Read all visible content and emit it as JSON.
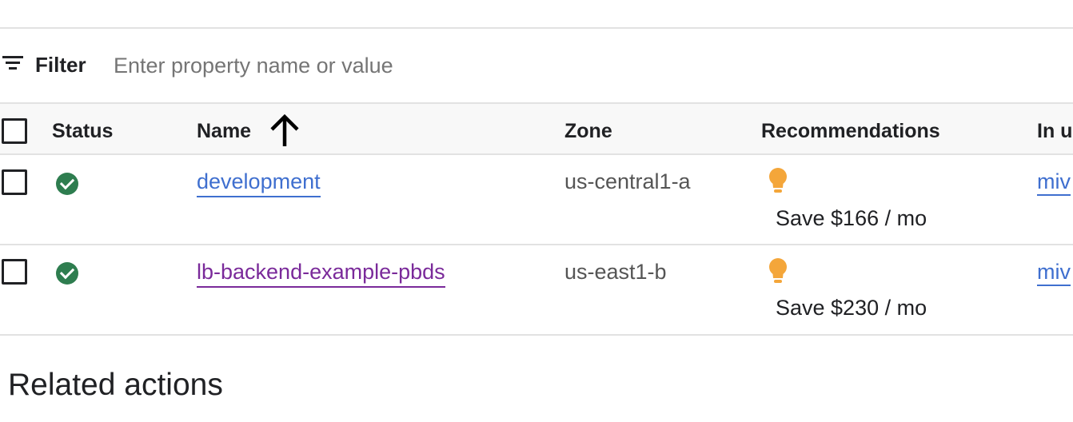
{
  "filter": {
    "label": "Filter",
    "placeholder": "Enter property name or value",
    "value": ""
  },
  "table": {
    "columns": {
      "status": "Status",
      "name": "Name",
      "zone": "Zone",
      "recommendations": "Recommendations",
      "in_use": "In u"
    },
    "sort": {
      "column": "Name",
      "direction": "ascending",
      "icon": "arrow-up-icon"
    },
    "rows": [
      {
        "status": "ok",
        "name": "development",
        "link_color": "#3f6fcf",
        "zone": "us-central1-a",
        "recommendation_icon": "lightbulb-icon",
        "recommendation": "Save $166 / mo",
        "in_use": "miv"
      },
      {
        "status": "ok",
        "name": "lb-backend-example-pbds",
        "link_color": "#7a2a9a",
        "zone": "us-east1-b",
        "recommendation_icon": "lightbulb-icon",
        "recommendation": "Save $230 / mo",
        "in_use": "miv"
      }
    ]
  },
  "related": {
    "title": "Related actions"
  },
  "colors": {
    "status_ok": "#2e7d4f",
    "bulb": "#f4a63a",
    "link": "#3f6fcf",
    "visited_link": "#7a2a9a"
  }
}
